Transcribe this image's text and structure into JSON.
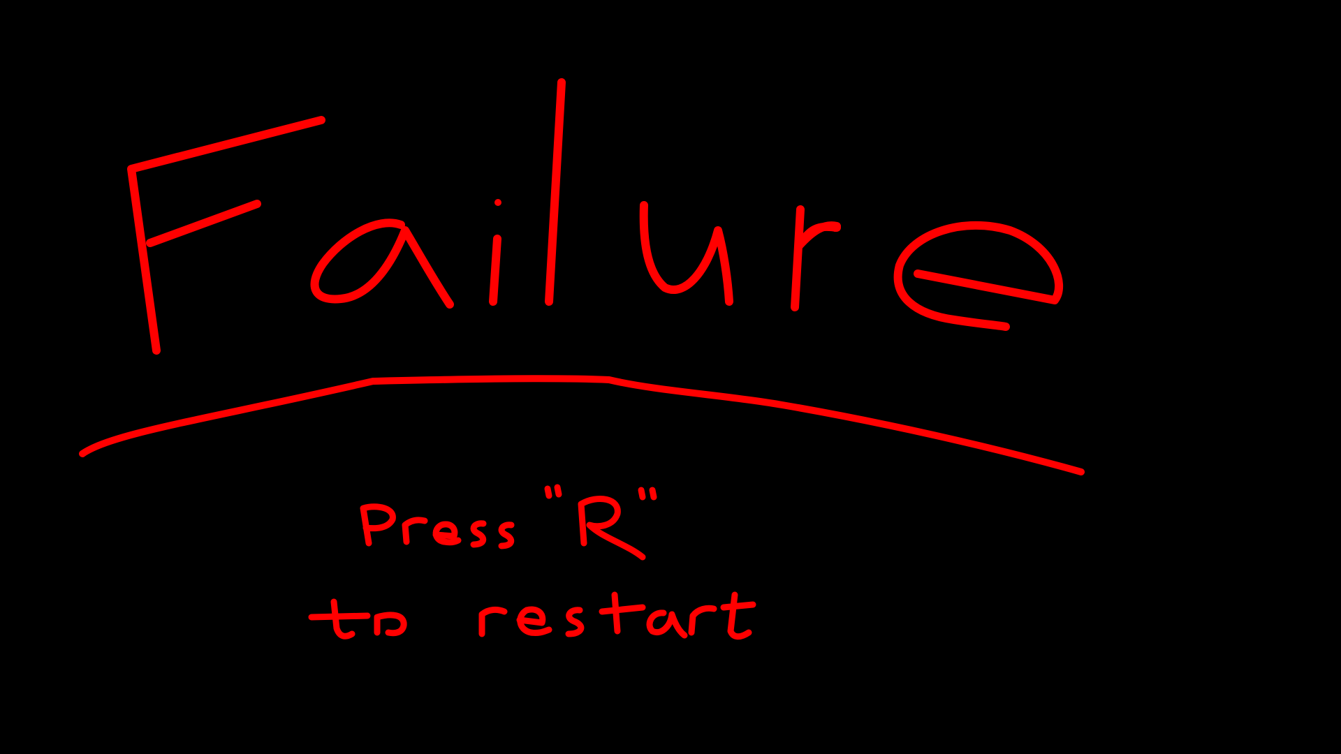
{
  "screen": {
    "title": "Failure",
    "prompt_line1": "Press \"R\"",
    "prompt_line2": "to restart"
  },
  "colors": {
    "background": "#000000",
    "ink": "#ff0000"
  }
}
